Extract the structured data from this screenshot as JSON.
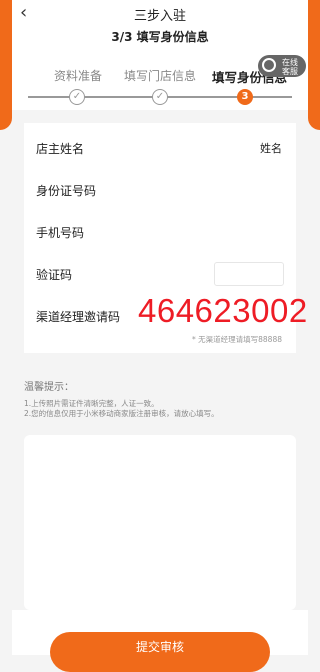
{
  "header": {
    "back_icon": "back-arrow-icon",
    "title": "三步入驻"
  },
  "progress": {
    "step_title": "3/3 填写身份信息",
    "steps": [
      {
        "label": "资料准备",
        "marker": "✓"
      },
      {
        "label": "填写门店信息",
        "marker": "✓"
      },
      {
        "label": "填写身份信息",
        "marker": "3"
      }
    ],
    "accent": "#f06a1a"
  },
  "float_service": {
    "icon": "headset-icon",
    "line1": "在线",
    "line2": "客服"
  },
  "form": {
    "owner_name": {
      "label": "店主姓名",
      "value": "姓名"
    },
    "id_number": {
      "label": "身份证号码"
    },
    "phone": {
      "label": "手机号码"
    },
    "verify_code": {
      "label": "验证码"
    },
    "invite": {
      "label": "渠道经理邀请码",
      "value": "464623002",
      "note": "* 无渠道经理请填写88888"
    }
  },
  "tips": {
    "title": "温馨提示：",
    "items": [
      "1.上传照片需证件清晰完整，人证一致。",
      "2.您的信息仅用于小米移动商家版注册审核，请放心填写。"
    ]
  },
  "submit": {
    "label": "提交审核"
  }
}
